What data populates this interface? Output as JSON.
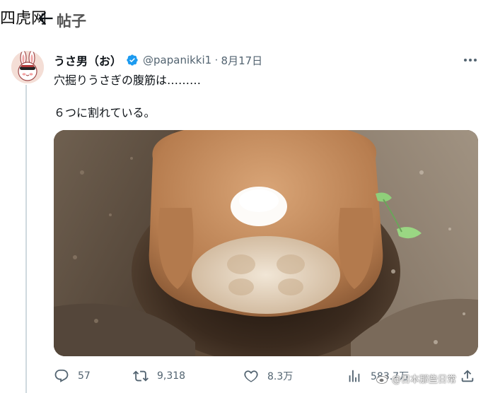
{
  "watermark": {
    "top_left": "四虎网",
    "bottom_right": "@日本那些日常"
  },
  "header": {
    "back_icon": "arrow-left-icon",
    "title": "帖子"
  },
  "tweet": {
    "author": {
      "display_name": "うさ男（お）",
      "handle": "@papanikki1",
      "separator": "·",
      "date": "8月17日",
      "verified_color": "#1d9bf0"
    },
    "text_line1": "穴掘りうさぎの腹筋は………",
    "text_line2": "６つに割れている。",
    "media": {
      "kind": "photo",
      "icon": "rabbit-digging-photo"
    },
    "actions": {
      "reply_count": "57",
      "retweet_count": "9,318",
      "like_count": "8.3万",
      "views_count": "583.7万"
    }
  },
  "colors": {
    "text": "#0f1419",
    "secondary": "#536471",
    "thread": "#cfd9de",
    "accent": "#1d9bf0"
  }
}
